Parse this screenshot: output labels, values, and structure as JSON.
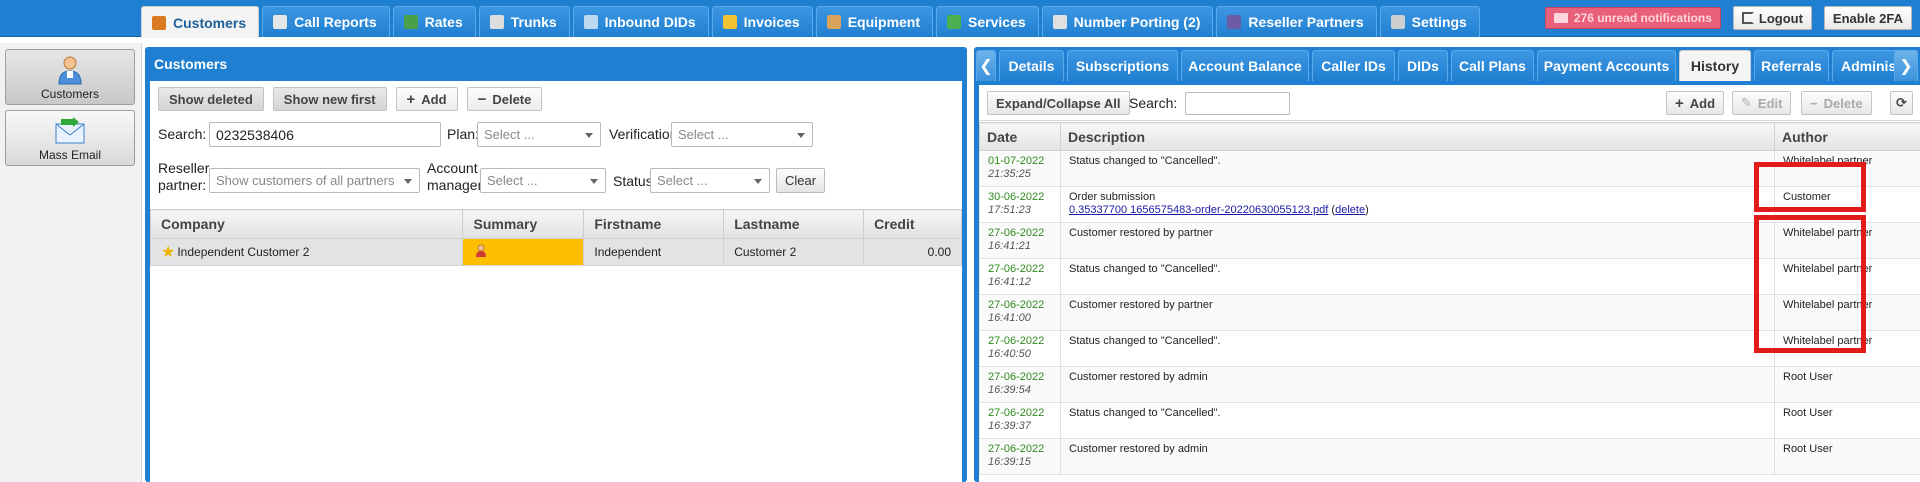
{
  "nav": {
    "tabs": [
      {
        "label": "Customers",
        "icon": "user-icon",
        "color": "#d97a1e",
        "active": true
      },
      {
        "label": "Call Reports",
        "icon": "report-icon",
        "color": "#e6e6e6"
      },
      {
        "label": "Rates",
        "icon": "grid-icon",
        "color": "#4aa04a"
      },
      {
        "label": "Trunks",
        "icon": "trunk-icon",
        "color": "#dddddd"
      },
      {
        "label": "Inbound DIDs",
        "icon": "did-icon",
        "color": "#bcd7f0"
      },
      {
        "label": "Invoices",
        "icon": "coins-icon",
        "color": "#f1c232"
      },
      {
        "label": "Equipment",
        "icon": "box-icon",
        "color": "#d9a35b"
      },
      {
        "label": "Services",
        "icon": "services-icon",
        "color": "#4caf50"
      },
      {
        "label": "Number Porting (2)",
        "icon": "porting-icon",
        "color": "#e0e0e0"
      },
      {
        "label": "Reseller Partners",
        "icon": "partner-icon",
        "color": "#6b5ca5"
      },
      {
        "label": "Settings",
        "icon": "gears-icon",
        "color": "#cfcfcf"
      }
    ],
    "notifications": "276 unread notifications",
    "logout_label": "Logout",
    "twofa_label": "Enable 2FA"
  },
  "quick": {
    "customers_label": "Customers",
    "mass_email_label": "Mass Email"
  },
  "customers": {
    "title": "Customers",
    "toolbar": {
      "show_deleted": "Show deleted",
      "show_new_first": "Show new first",
      "add": "Add",
      "delete": "Delete"
    },
    "filters": {
      "search_label": "Search:",
      "search_value": "0232538406",
      "plan_label": "Plan:",
      "plan_placeholder": "Select ...",
      "verification_label": "Verification:",
      "verification_placeholder": "Select ...",
      "reseller_label_1": "Reseller",
      "reseller_label_2": "partner:",
      "reseller_placeholder": "Show customers of all partners",
      "manager_label_1": "Account",
      "manager_label_2": "manager:",
      "manager_placeholder": "Select ...",
      "status_label": "Status:",
      "status_placeholder": "Select ...",
      "clear": "Clear"
    },
    "columns": [
      "Company",
      "Summary",
      "Firstname",
      "Lastname",
      "Credit"
    ],
    "rows": [
      {
        "company": "Independent Customer 2",
        "firstname": "Independent",
        "lastname": "Customer 2",
        "credit": "0.00"
      }
    ]
  },
  "details": {
    "tabs": [
      "Details",
      "Subscriptions",
      "Account Balance",
      "Caller IDs",
      "DIDs",
      "Call Plans",
      "Payment Accounts",
      "History",
      "Referrals",
      "Adminis"
    ],
    "active_tab": "History",
    "history": {
      "expand_label": "Expand/Collapse All",
      "search_label": "Search:",
      "add": "Add",
      "edit": "Edit",
      "delete": "Delete",
      "columns": [
        "Date",
        "Description",
        "Author"
      ],
      "rows": [
        {
          "date": "01-07-2022",
          "time": "21:35:25",
          "desc": "Status changed to \"Cancelled\".",
          "author": "Whitelabel partner"
        },
        {
          "date": "30-06-2022",
          "time": "17:51:23",
          "desc": "Order submission",
          "link": "0.35337700 1656575483-order-20220630055123.pdf",
          "del": "delete",
          "author": "Customer"
        },
        {
          "date": "27-06-2022",
          "time": "16:41:21",
          "desc": "Customer restored by partner",
          "author": "Whitelabel partner"
        },
        {
          "date": "27-06-2022",
          "time": "16:41:12",
          "desc": "Status changed to \"Cancelled\".",
          "author": "Whitelabel partner"
        },
        {
          "date": "27-06-2022",
          "time": "16:41:00",
          "desc": "Customer restored by partner",
          "author": "Whitelabel partner"
        },
        {
          "date": "27-06-2022",
          "time": "16:40:50",
          "desc": "Status changed to \"Cancelled\".",
          "author": "Whitelabel partner"
        },
        {
          "date": "27-06-2022",
          "time": "16:39:54",
          "desc": "Customer restored by admin",
          "author": "Root User"
        },
        {
          "date": "27-06-2022",
          "time": "16:39:37",
          "desc": "Status changed to \"Cancelled\".",
          "author": "Root User"
        },
        {
          "date": "27-06-2022",
          "time": "16:39:15",
          "desc": "Customer restored by admin",
          "author": "Root User"
        }
      ]
    }
  },
  "colors": {
    "accent_blue": "#1f7fd0",
    "highlight_red": "#e21b1b",
    "summary_yellow": "#ffbf00",
    "date_green": "#2e8b1e"
  }
}
